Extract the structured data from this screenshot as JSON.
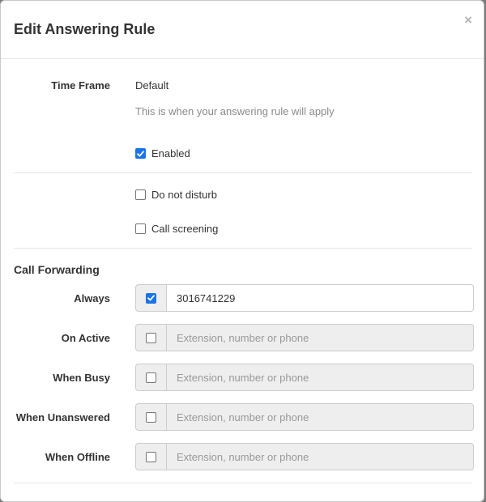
{
  "modal": {
    "title": "Edit Answering Rule",
    "close_label": "×"
  },
  "time_frame": {
    "label": "Time Frame",
    "value": "Default",
    "help": "This is when your answering rule will apply"
  },
  "options": {
    "enabled": {
      "label": "Enabled",
      "checked": true
    },
    "do_not_disturb": {
      "label": "Do not disturb",
      "checked": false
    },
    "call_screening": {
      "label": "Call screening",
      "checked": false
    }
  },
  "call_forwarding": {
    "title": "Call Forwarding",
    "rows": [
      {
        "label": "Always",
        "checked": true,
        "value": "3016741229",
        "placeholder": "Extension, number or phone"
      },
      {
        "label": "On Active",
        "checked": false,
        "value": "",
        "placeholder": "Extension, number or phone"
      },
      {
        "label": "When Busy",
        "checked": false,
        "value": "",
        "placeholder": "Extension, number or phone"
      },
      {
        "label": "When Unanswered",
        "checked": false,
        "value": "",
        "placeholder": "Extension, number or phone"
      },
      {
        "label": "When Offline",
        "checked": false,
        "value": "",
        "placeholder": "Extension, number or phone"
      }
    ]
  },
  "colors": {
    "accent": "#1a73e8",
    "disabled_bg": "#eeeeee"
  }
}
